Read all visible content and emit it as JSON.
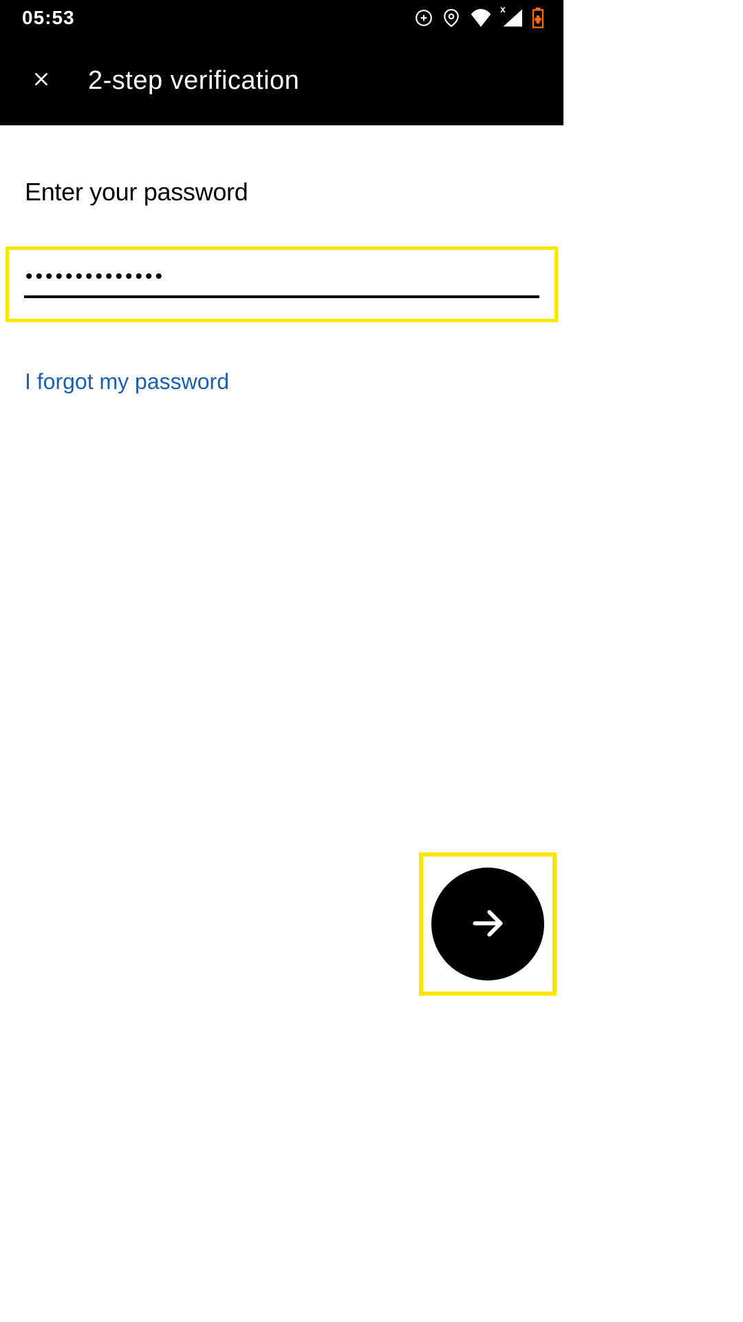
{
  "statusBar": {
    "time": "05:53"
  },
  "appBar": {
    "title": "2-step verification"
  },
  "content": {
    "heading": "Enter your password",
    "passwordValue": "••••••••••••••",
    "forgotLink": "I forgot my password"
  }
}
